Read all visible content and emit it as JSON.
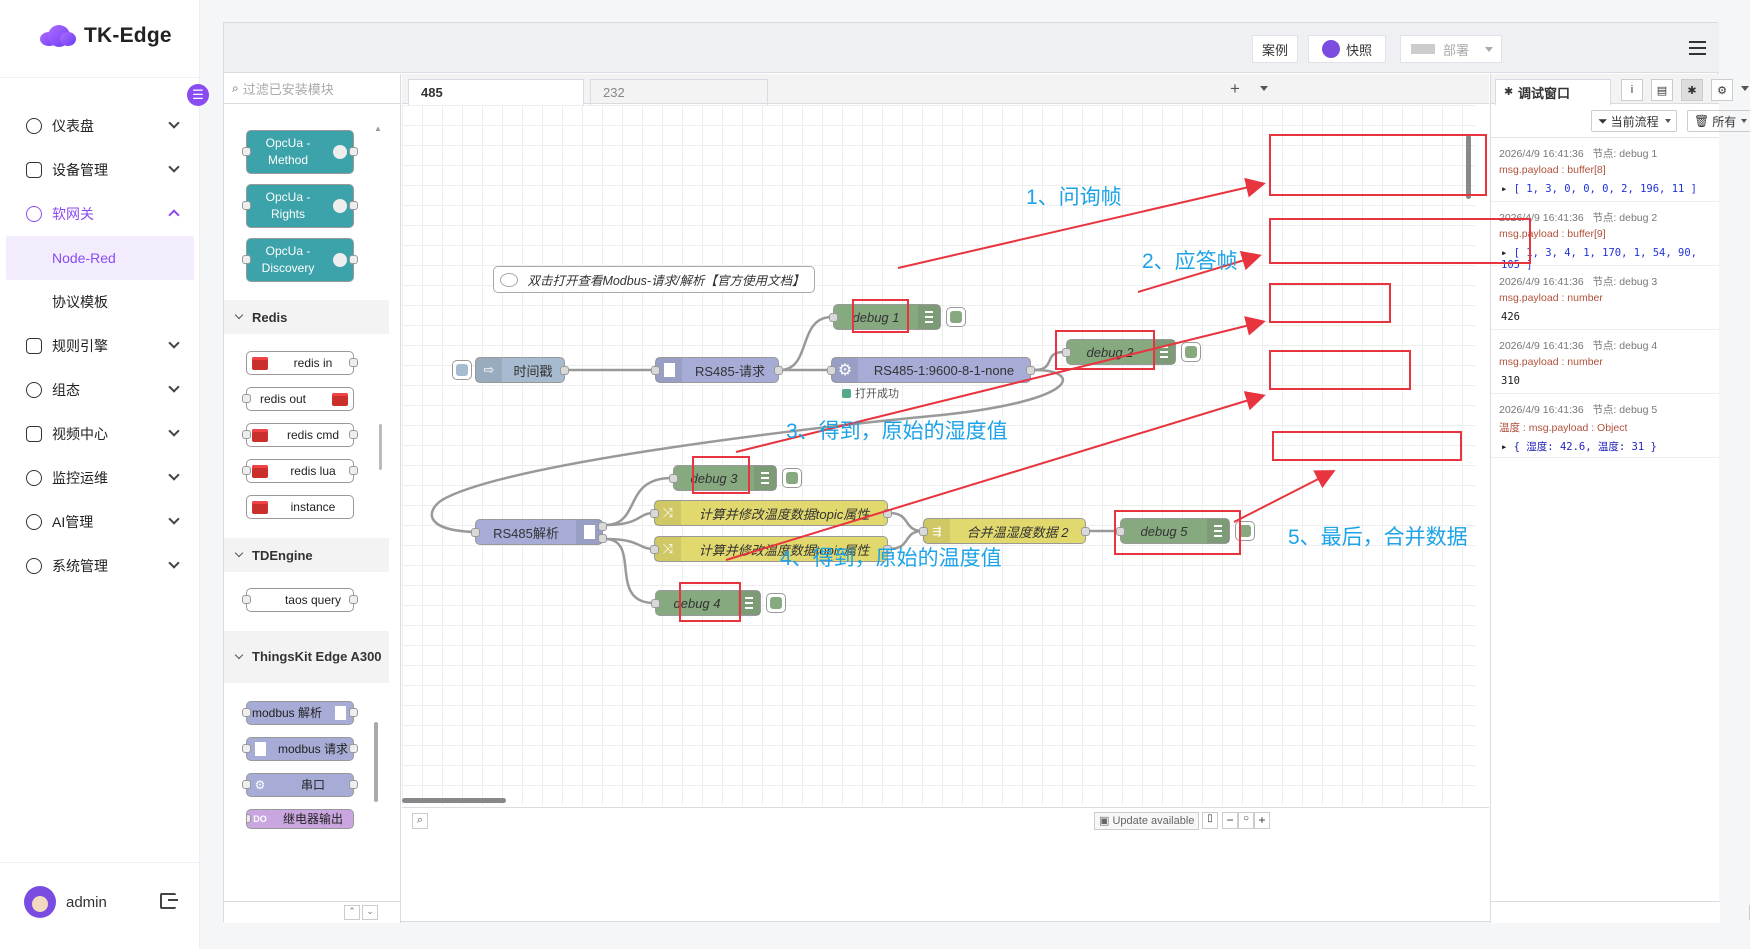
{
  "app": {
    "name": "TK-Edge"
  },
  "sidebar": {
    "items": [
      {
        "label": "仪表盘",
        "icon": "dashboard-icon"
      },
      {
        "label": "设备管理",
        "icon": "device-icon"
      },
      {
        "label": "软网关",
        "icon": "gateway-icon",
        "expanded": true,
        "children": [
          {
            "label": "Node-Red",
            "selected": true
          },
          {
            "label": "协议模板"
          }
        ]
      },
      {
        "label": "规则引擎",
        "icon": "rule-icon"
      },
      {
        "label": "组态",
        "icon": "scada-icon"
      },
      {
        "label": "视频中心",
        "icon": "video-icon"
      },
      {
        "label": "监控运维",
        "icon": "monitor-icon"
      },
      {
        "label": "AI管理",
        "icon": "ai-icon"
      },
      {
        "label": "系统管理",
        "icon": "settings-icon"
      }
    ],
    "user": "admin"
  },
  "header": {
    "examples": "案例",
    "snapshot": "快照",
    "deploy": "部署"
  },
  "palette": {
    "search_placeholder": "过滤已安装模块",
    "opcua": [
      "OpcUa -\nMethod",
      "OpcUa -\nRights",
      "OpcUa -\nDiscovery"
    ],
    "redis_title": "Redis",
    "redis": [
      "redis in",
      "redis out",
      "redis cmd",
      "redis lua",
      "instance"
    ],
    "tdengine_title": "TDEngine",
    "tdengine": [
      "taos query"
    ],
    "thingskit_title": "ThingsKit Edge A300",
    "thingskit": [
      "modbus 解析",
      "modbus 请求",
      "串口",
      "继电器输出"
    ]
  },
  "workspace": {
    "tabs": [
      "485",
      "232"
    ],
    "comment": "双击打开查看Modbus-请求/解析【官方使用文档】",
    "nodes": {
      "inject": "时间戳",
      "request": "RS485-请求",
      "serial": "RS485-1:9600-8-1-none",
      "serial_status": "打开成功",
      "parse": "RS485解析",
      "func1": "计算并修改温度数据topic属性",
      "func2": "计算并修改温度数据topic属性",
      "join": "合并温湿度数据 2",
      "debug1": "debug 1",
      "debug2": "debug 2",
      "debug3": "debug 3",
      "debug4": "debug 4",
      "debug5": "debug 5"
    },
    "footer_update": "Update available"
  },
  "annotations": {
    "a1": "1、问询帧",
    "a2": "2、应答帧",
    "a3": "3、得到，原始的湿度值",
    "a4": "4、得到，原始的温度值",
    "a5": "5、最后，合并数据",
    "color": "#e8343f",
    "text_color": "#1ca3e8"
  },
  "debug_panel": {
    "tab": "调试窗口",
    "filter_flow": "当前流程",
    "filter_all": "所有",
    "messages": [
      {
        "time": "2026/4/9 16:41:36",
        "node": "节点: debug 1",
        "prop": "msg.payload : buffer[8]",
        "value": "[ 1, 3, 0, 0, 0, 2, 196, 11 ]"
      },
      {
        "time": "2026/4/9 16:41:36",
        "node": "节点: debug 2",
        "prop": "msg.payload : buffer[9]",
        "value": "[ 1, 3, 4, 1, 170, 1, 54, 90, 105 ]"
      },
      {
        "time": "2026/4/9 16:41:36",
        "node": "节点: debug 3",
        "prop": "msg.payload : number",
        "value": "426"
      },
      {
        "time": "2026/4/9 16:41:36",
        "node": "节点: debug 4",
        "prop": "msg.payload : number",
        "value": "310"
      },
      {
        "time": "2026/4/9 16:41:36",
        "node": "节点: debug 5",
        "prop": "温度 : msg.payload : Object",
        "value": "{ 湿度: 42.6, 温度: 31 }"
      }
    ]
  }
}
